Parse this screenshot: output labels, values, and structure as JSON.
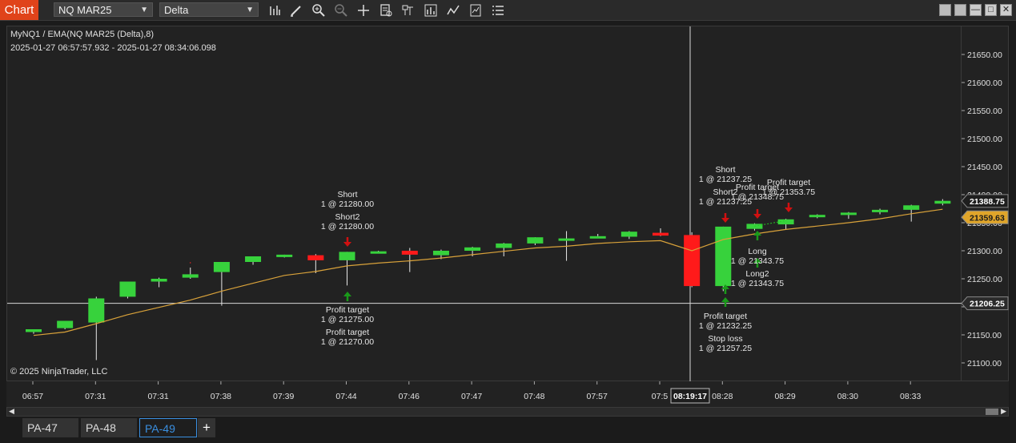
{
  "toolbar": {
    "chart_label": "Chart",
    "instrument": "NQ MAR25",
    "bar_type": "Delta",
    "icons": [
      "bars-icon",
      "draw-icon",
      "zoom-in-icon",
      "zoom-out-icon",
      "crosshair-icon",
      "data-box-icon",
      "properties-icon",
      "strategy-icon",
      "indicator-icon",
      "template-icon",
      "list-icon"
    ]
  },
  "window_buttons": [
    "restore-icon",
    "restore-icon",
    "minimize-icon",
    "maximize-icon",
    "close-icon"
  ],
  "chart": {
    "title": "MyNQ1 / EMA(NQ MAR25 (Delta),8)",
    "range": "2025-01-27 06:57:57.932 - 2025-01-27 08:34:06.098",
    "copyright": "© 2025 NinjaTrader, LLC"
  },
  "chart_data": {
    "type": "candlestick",
    "instrument": "NQ MAR25",
    "ylim": [
      21070,
      21690
    ],
    "y_ticks": [
      "21650.00",
      "21600.00",
      "21550.00",
      "21500.00",
      "21450.00",
      "21400.00",
      "21350.00",
      "21300.00",
      "21250.00",
      "21200.00",
      "21150.00",
      "21100.00"
    ],
    "x_ticks": [
      "06:57",
      "07:31",
      "07:31",
      "07:38",
      "07:39",
      "07:44",
      "07:46",
      "07:47",
      "07:48",
      "07:57",
      "07:5",
      "08:28",
      "08:29",
      "08:30",
      "08:33"
    ],
    "candles": [
      {
        "o": 21155,
        "h": 21160,
        "l": 21152,
        "c": 21160
      },
      {
        "o": 21162,
        "h": 21175,
        "l": 21160,
        "c": 21175
      },
      {
        "o": 21172,
        "h": 21218,
        "l": 21105,
        "c": 21215
      },
      {
        "o": 21218,
        "h": 21245,
        "l": 21215,
        "c": 21245
      },
      {
        "o": 21245,
        "h": 21252,
        "l": 21235,
        "c": 21250
      },
      {
        "o": 21252,
        "h": 21270,
        "l": 21250,
        "c": 21258
      },
      {
        "o": 21262,
        "h": 21280,
        "l": 21202,
        "c": 21280
      },
      {
        "o": 21280,
        "h": 21290,
        "l": 21275,
        "c": 21290
      },
      {
        "o": 21290,
        "h": 21293,
        "l": 21288,
        "c": 21293
      },
      {
        "o": 21292,
        "h": 21294,
        "l": 21260,
        "c": 21283
      },
      {
        "o": 21283,
        "h": 21298,
        "l": 21238,
        "c": 21298
      },
      {
        "o": 21298,
        "h": 21300,
        "l": 21296,
        "c": 21299
      },
      {
        "o": 21300,
        "h": 21305,
        "l": 21262,
        "c": 21293
      },
      {
        "o": 21292,
        "h": 21302,
        "l": 21285,
        "c": 21300
      },
      {
        "o": 21300,
        "h": 21307,
        "l": 21290,
        "c": 21306
      },
      {
        "o": 21305,
        "h": 21314,
        "l": 21290,
        "c": 21313
      },
      {
        "o": 21313,
        "h": 21324,
        "l": 21310,
        "c": 21324
      },
      {
        "o": 21322,
        "h": 21335,
        "l": 21282,
        "c": 21322
      },
      {
        "o": 21324,
        "h": 21330,
        "l": 21323,
        "c": 21326
      },
      {
        "o": 21325,
        "h": 21335,
        "l": 21321,
        "c": 21334
      },
      {
        "o": 21332,
        "h": 21340,
        "l": 21326,
        "c": 21327
      },
      {
        "o": 21328,
        "h": 21333,
        "l": 21235,
        "c": 21237
      },
      {
        "o": 21237,
        "h": 21343,
        "l": 21228,
        "c": 21343
      },
      {
        "o": 21339,
        "h": 21349,
        "l": 21336,
        "c": 21348
      },
      {
        "o": 21347,
        "h": 21357,
        "l": 21338,
        "c": 21356
      },
      {
        "o": 21360,
        "h": 21365,
        "l": 21358,
        "c": 21364
      },
      {
        "o": 21364,
        "h": 21369,
        "l": 21357,
        "c": 21368
      },
      {
        "o": 21369,
        "h": 21375,
        "l": 21365,
        "c": 21373
      },
      {
        "o": 21373,
        "h": 21382,
        "l": 21352,
        "c": 21381
      },
      {
        "o": 21384,
        "h": 21392,
        "l": 21381,
        "c": 21389
      }
    ],
    "ema": [
      21149,
      21155,
      21170,
      21186,
      21199,
      21212,
      21228,
      21242,
      21256,
      21263,
      21273,
      21278,
      21282,
      21287,
      21293,
      21299,
      21305,
      21308,
      21313,
      21316,
      21318,
      21300,
      21320,
      21330,
      21338,
      21344,
      21350,
      21357,
      21366,
      21374
    ],
    "price_markers": {
      "last_price": "21388.75",
      "ema_value": "21359.63",
      "crosshair_price": "21206.25",
      "crosshair_time": "08:19:17"
    },
    "executions": [
      {
        "label": "Short",
        "detail": "1 @ 21280.00"
      },
      {
        "label": "Short2",
        "detail": "1 @ 21280.00"
      },
      {
        "label": "Profit target",
        "detail": "1 @ 21275.00"
      },
      {
        "label": "Profit target",
        "detail": "1 @ 21270.00"
      },
      {
        "label": "Short",
        "detail": "1 @ 21237.25"
      },
      {
        "label": "Short2",
        "detail": "1 @ 21237.25"
      },
      {
        "label": "Profit target",
        "detail": "1 @ 21348.75"
      },
      {
        "label": "Profit target",
        "detail": "1 @ 21353.75"
      },
      {
        "label": "Long",
        "detail": "1 @ 21343.75"
      },
      {
        "label": "Long2",
        "detail": "1 @ 21343.75"
      },
      {
        "label": "Profit target",
        "detail": "1 @ 21232.25"
      },
      {
        "label": "Stop loss",
        "detail": "1 @ 21257.25"
      }
    ],
    "colors": {
      "up": "#37d23c",
      "down": "#ff1a1a",
      "ema": "#d9a23a",
      "marker_up": "#1a9a1a",
      "marker_down": "#d01010",
      "ema_badge": "#e0a52a"
    }
  },
  "tabs": [
    {
      "label": "PA-47"
    },
    {
      "label": "PA-48"
    },
    {
      "label": "PA-49"
    }
  ],
  "add_tab": "+"
}
